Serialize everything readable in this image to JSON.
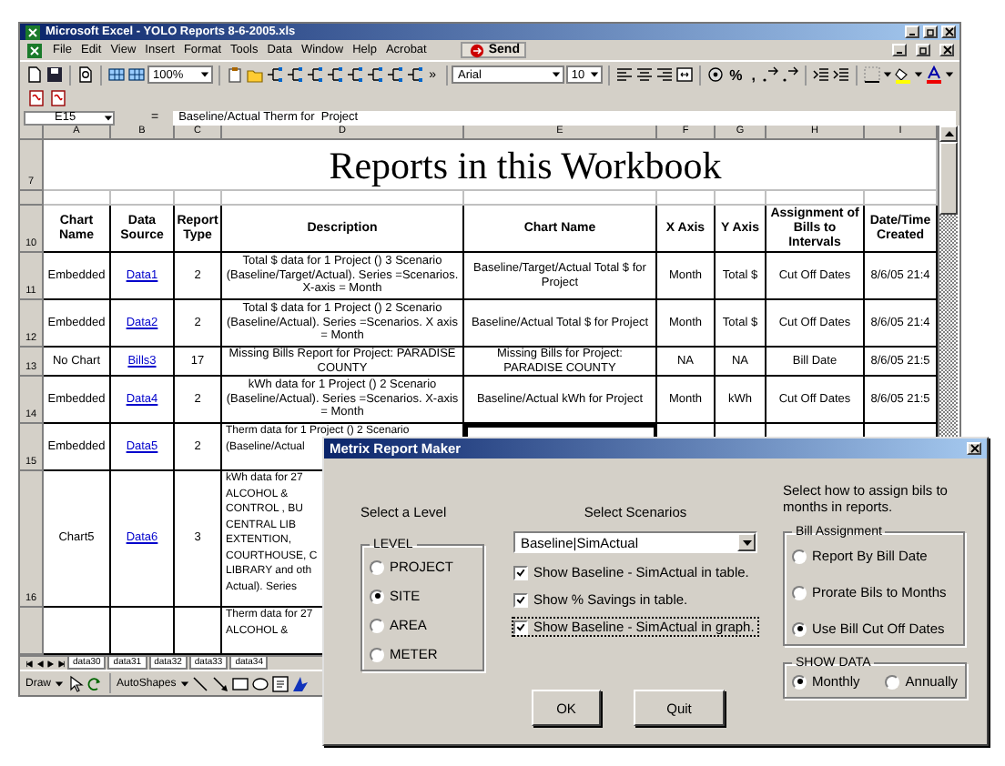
{
  "window": {
    "title": "Microsoft Excel - YOLO Reports 8-6-2005.xls"
  },
  "menu": [
    "File",
    "Edit",
    "View",
    "Insert",
    "Format",
    "Tools",
    "Data",
    "Window",
    "Help",
    "Acrobat"
  ],
  "send_button": "Send",
  "toolbar": {
    "zoom": "100%",
    "more": "»",
    "font": "Arial",
    "size": "10",
    "format_buttons": [
      "%",
      ","
    ]
  },
  "formula_bar": {
    "cell": "E15",
    "equals": "=",
    "value": "Baseline/Actual Therm for  Project"
  },
  "columns": [
    "A",
    "B",
    "C",
    "D",
    "E",
    "F",
    "G",
    "H",
    "I"
  ],
  "title_row": "7",
  "header_row": "10",
  "sheet_title": "Reports in this Workbook",
  "headers": [
    "Chart Name",
    "Data Source",
    "Report Type",
    "Description",
    "Chart Name",
    "X Axis",
    "Y Axis",
    "Assignment of Bills to Intervals",
    "Date/Time Created"
  ],
  "rows": [
    {
      "number": "11",
      "cells": [
        "Embedded",
        "Data1",
        "2",
        "Total $ data for 1 Project () 3 Scenario (Baseline/Target/Actual).  Series =Scenarios.  X-axis = Month",
        "Baseline/Target/Actual Total $ for Project",
        "Month",
        "Total $",
        "Cut Off Dates",
        "8/6/05 21:4"
      ]
    },
    {
      "number": "12",
      "cells": [
        "Embedded",
        "Data2",
        "2",
        "Total $ data for 1 Project () 2 Scenario (Baseline/Actual).  Series =Scenarios.  X axis = Month",
        "Baseline/Actual Total $ for  Project",
        "Month",
        "Total $",
        "Cut Off Dates",
        "8/6/05 21:4"
      ]
    },
    {
      "number": "13",
      "cells": [
        "No Chart",
        "Bills3",
        "17",
        "Missing Bills Report for Project: PARADISE COUNTY",
        "Missing Bills for Project: PARADISE COUNTY",
        "NA",
        "NA",
        "Bill Date",
        "8/6/05 21:5"
      ]
    },
    {
      "number": "14",
      "cells": [
        "Embedded",
        "Data4",
        "2",
        "kWh data for 1 Project () 2 Scenario (Baseline/Actual).  Series =Scenarios.  X-axis = Month",
        "Baseline/Actual kWh for  Project",
        "Month",
        "kWh",
        "Cut Off Dates",
        "8/6/05 21:5"
      ]
    }
  ],
  "partial_rows": [
    {
      "number": "15",
      "cells": [
        "Embedded",
        "Data5",
        "2"
      ],
      "description": [
        "Therm data for 1 Project () 2 Scenario",
        "(Baseline/Actual"
      ],
      "right_cells": [
        {
          "selected": true
        },
        {
          "selected": false
        },
        {
          "selected": false
        },
        {
          "selected": false
        },
        {
          "selected": false
        }
      ]
    },
    {
      "number": "16",
      "cells": [
        "Chart5",
        "Data6",
        "3"
      ],
      "description": [
        "kWh data for 27",
        "ALCOHOL &",
        "CONTROL , BU",
        "CENTRAL LIB",
        "EXTENTION,",
        "COURTHOUSE, C",
        "LIBRARY and oth",
        "Actual).  Series"
      ]
    },
    {
      "description": [
        "Therm data for 27",
        "ALCOHOL &"
      ]
    }
  ],
  "sheet_tabs": [
    "data30",
    "data31",
    "data32",
    "data33",
    "data34"
  ],
  "drawing_toolbar": {
    "draw": "Draw",
    "autoshapes": "AutoShapes"
  },
  "dialog": {
    "title": "Metrix Report Maker",
    "level": {
      "heading": "Select a Level",
      "group": "LEVEL",
      "options": [
        {
          "label": "PROJECT",
          "selected": false
        },
        {
          "label": "SITE",
          "selected": true
        },
        {
          "label": "AREA",
          "selected": false
        },
        {
          "label": "METER",
          "selected": false
        }
      ]
    },
    "scenarios": {
      "heading": "Select Scenarios",
      "dropdown": "Baseline|SimActual",
      "checkboxes": [
        {
          "label": "Show Baseline - SimActual in table.",
          "checked": true
        },
        {
          "label": "Show % Savings in table.",
          "checked": true
        },
        {
          "label": "Show Baseline - SimActual in graph.",
          "checked": true
        }
      ]
    },
    "assignment": {
      "heading": "Select how to assign bils to months in reports.",
      "group": "Bill Assignment",
      "options": [
        {
          "label": "Report By Bill Date",
          "selected": false
        },
        {
          "label": "Prorate Bils to Months",
          "selected": false
        },
        {
          "label": "Use Bill Cut Off Dates",
          "selected": true
        }
      ]
    },
    "show_data": {
      "group": "SHOW DATA",
      "options": [
        {
          "label": "Monthly",
          "selected": true
        },
        {
          "label": "Annually",
          "selected": false
        }
      ]
    },
    "buttons": [
      "OK",
      "Quit"
    ]
  }
}
